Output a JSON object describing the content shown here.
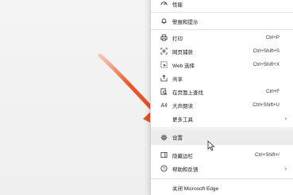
{
  "menu": {
    "items": [
      {
        "label": "性能",
        "shortcut": "",
        "icon": "performance-icon"
      },
      {
        "label": "警报和提示",
        "shortcut": "",
        "icon": "bell-icon"
      },
      {
        "label": "打印",
        "shortcut": "Ctrl+P",
        "icon": "print-icon"
      },
      {
        "label": "网页捕获",
        "shortcut": "Ctrl+Shift+S",
        "icon": "web-capture-icon"
      },
      {
        "label": "Web 选择",
        "shortcut": "Ctrl+Shift+X",
        "icon": "web-select-icon"
      },
      {
        "label": "共享",
        "shortcut": "",
        "icon": "share-icon"
      },
      {
        "label": "在页面上查找",
        "shortcut": "Ctrl+F",
        "icon": "find-icon"
      },
      {
        "label": "大声朗读",
        "shortcut": "Ctrl+Shift+U",
        "icon": "read-aloud-icon"
      },
      {
        "label": "更多工具",
        "shortcut": "",
        "icon": "more-tools-icon"
      },
      {
        "label": "设置",
        "shortcut": "",
        "icon": "gear-icon"
      },
      {
        "label": "隐藏边栏",
        "shortcut": "Ctrl+Shift+/",
        "icon": "sidebar-icon"
      },
      {
        "label": "帮助和反馈",
        "shortcut": "",
        "icon": "help-icon"
      },
      {
        "label": "关闭 Microsoft Edge",
        "shortcut": "",
        "icon": ""
      }
    ],
    "highlighted_item": "设置"
  },
  "colors": {
    "arrow": "#e8542a",
    "highlight": "#ececec",
    "menu_bg": "#ffffff"
  }
}
